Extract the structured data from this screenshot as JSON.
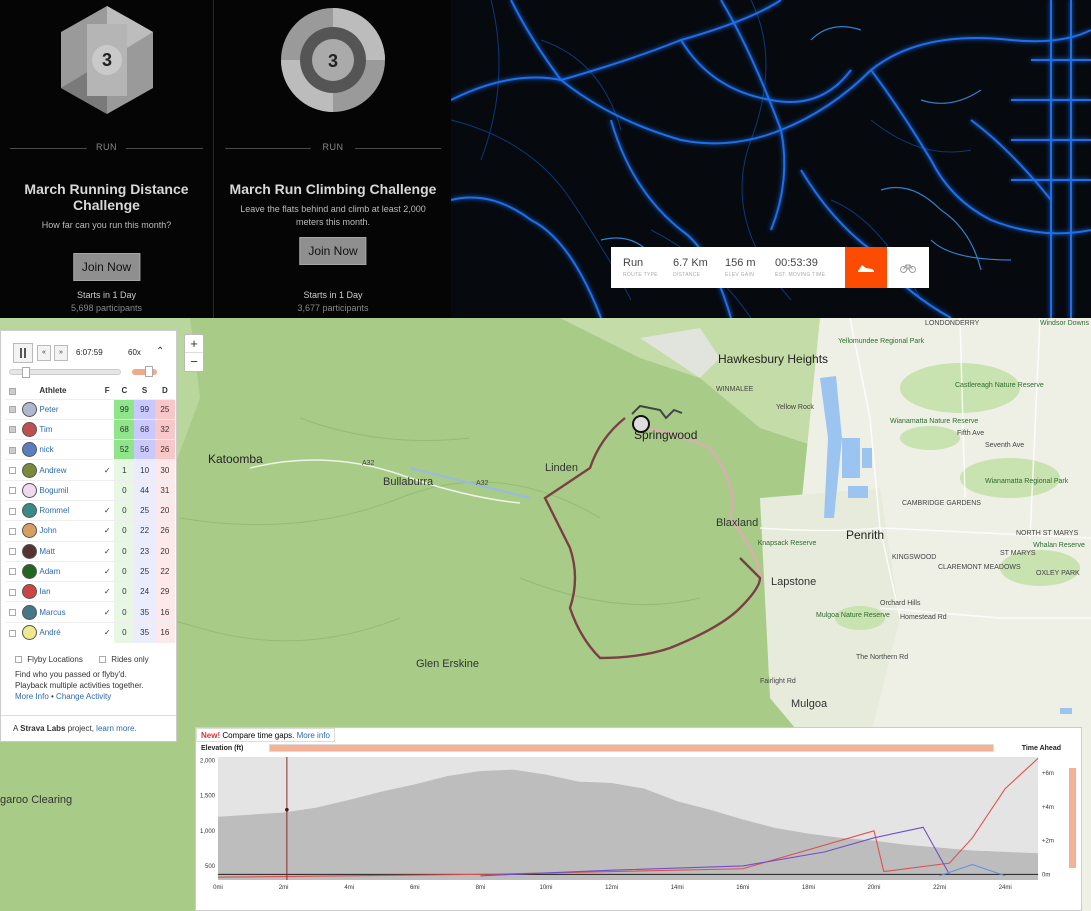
{
  "challenges": [
    {
      "badge_number": "3",
      "sport": "RUN",
      "title": "March Running Distance Challenge",
      "description": "How far can you run this month?",
      "button": "Join Now",
      "starts": "Starts in 1 Day",
      "participants": "5,698 participants"
    },
    {
      "badge_number": "3",
      "sport": "RUN",
      "title": "March Run Climbing Challenge",
      "description": "Leave the flats behind and climb at least 2,000 meters this month.",
      "button": "Join Now",
      "starts": "Starts in 1 Day",
      "participants": "3,677 participants"
    }
  ],
  "route_builder": {
    "type_value": "Run",
    "type_label": "ROUTE TYPE",
    "distance_value": "6.7 Km",
    "distance_label": "DISTANCE",
    "elev_value": "156 m",
    "elev_label": "ELEV GAIN",
    "time_value": "00:53:39",
    "time_label": "EST. MOVING TIME",
    "run_icon": "shoe-icon",
    "bike_icon": "bike-icon",
    "accent": "#fc4c02"
  },
  "playback": {
    "time": "6:07:59",
    "speed": "60x",
    "rewind": "«",
    "forward": "»"
  },
  "athlete_table": {
    "headers": {
      "athlete": "Athlete",
      "c": "C",
      "s": "S",
      "d": "D"
    },
    "rows": [
      {
        "name": "Peter",
        "checked": true,
        "flag": "",
        "c": "99",
        "s": "99",
        "d": "25",
        "color": "#b0b8d0"
      },
      {
        "name": "Tim",
        "checked": true,
        "flag": "",
        "c": "68",
        "s": "68",
        "d": "32",
        "color": "#c05050"
      },
      {
        "name": "nick",
        "checked": true,
        "flag": "",
        "c": "52",
        "s": "56",
        "d": "26",
        "color": "#5a7fc0"
      },
      {
        "name": "Andrew",
        "checked": false,
        "flag": "✓",
        "c": "1",
        "s": "10",
        "d": "30",
        "color": "#7a8a3a"
      },
      {
        "name": "Bogumil",
        "checked": false,
        "flag": "",
        "c": "0",
        "s": "44",
        "d": "31",
        "color": "#f0d8f0"
      },
      {
        "name": "Rommel",
        "checked": false,
        "flag": "✓",
        "c": "0",
        "s": "25",
        "d": "20",
        "color": "#3a8a8a"
      },
      {
        "name": "John",
        "checked": false,
        "flag": "✓",
        "c": "0",
        "s": "22",
        "d": "26",
        "color": "#d8a060"
      },
      {
        "name": "Matt",
        "checked": false,
        "flag": "✓",
        "c": "0",
        "s": "23",
        "d": "20",
        "color": "#553333"
      },
      {
        "name": "Adam",
        "checked": false,
        "flag": "✓",
        "c": "0",
        "s": "25",
        "d": "22",
        "color": "#226622"
      },
      {
        "name": "Ian",
        "checked": false,
        "flag": "✓",
        "c": "0",
        "s": "24",
        "d": "29",
        "color": "#cc4444"
      },
      {
        "name": "Marcus",
        "checked": false,
        "flag": "✓",
        "c": "0",
        "s": "35",
        "d": "16",
        "color": "#447788"
      },
      {
        "name": "André",
        "checked": false,
        "flag": "✓",
        "c": "0",
        "s": "35",
        "d": "16",
        "color": "#f0e890"
      }
    ]
  },
  "options": {
    "flyby_locations": "Flyby Locations",
    "rides_only": "Rides only"
  },
  "info": {
    "line1": "Find who you passed or flyby'd.",
    "line2": "Playback multiple activities together.",
    "more_info": "More Info",
    "separator": " • ",
    "change_activity": "Change Activity"
  },
  "footer": {
    "prefix": "A ",
    "brand": "Strava Labs",
    "middle": " project, ",
    "learn_more": "learn more."
  },
  "map_labels": {
    "katoomba": "Katoomba",
    "bullaburra": "Bullaburra",
    "linden": "Linden",
    "springwood": "Springwood",
    "hawkesbury": "Hawkesbury Heights",
    "blaxland": "Blaxland",
    "lapstone": "Lapstone",
    "penrith": "Penrith",
    "glen_erskine": "Glen Erskine",
    "mulgoa": "Mulgoa",
    "kangaroo": "garoo Clearing",
    "yellow_rock": "Yellow Rock",
    "winmalee": "WINMALEE",
    "kingswood": "KINGSWOOD",
    "cambridge": "CAMBRIDGE GARDENS",
    "claremont": "CLAREMONT MEADOWS",
    "north_st_marys": "NORTH ST MARYS",
    "st_marys": "ST MARYS",
    "londonderry": "LONDONDERRY",
    "yellomundee": "Yellomundee Regional Park",
    "castlereagh": "Castlereagh Nature Reserve",
    "wianamatta1": "Wianamatta Nature Reserve",
    "wianamatta2": "Wianamatta Regional Park",
    "knapsack": "Knapsack Reserve",
    "mulgoa_nr": "Mulgoa Nature Reserve",
    "whalan": "Whalan Reserve",
    "windsor_downs": "Windsor Downs Nature Reserve",
    "fifth_ave": "Fifth Ave",
    "seventh_ave": "Seventh Ave",
    "homestead": "Homestead Rd",
    "a32": "A32",
    "a32b": "A32",
    "orchard": "Orchard Hills",
    "northern": "The Northern Rd",
    "fairlight": "Fairlight Rd",
    "oxley": "OXLEY PARK"
  },
  "elevation": {
    "notice_new": "New!",
    "notice_text": " Compare time gaps. ",
    "notice_link": "More info",
    "title": "Elevation (ft)",
    "right_title": "Time Ahead"
  },
  "chart_data": {
    "type": "area",
    "xlabel": "",
    "ylabel": "Elevation (ft)",
    "x_ticks": [
      "0mi",
      "2mi",
      "4mi",
      "6mi",
      "8mi",
      "10mi",
      "12mi",
      "14mi",
      "16mi",
      "18mi",
      "20mi",
      "22mi",
      "24mi"
    ],
    "y_ticks": [
      "500",
      "1,000",
      "1,500",
      "2,000"
    ],
    "y2_ticks": [
      "0m",
      "+2m",
      "+4m",
      "+6m"
    ],
    "xlim": [
      0,
      25
    ],
    "ylim": [
      300,
      2050
    ],
    "cursor_x": 2.1,
    "elevation_profile": {
      "x": [
        0,
        1,
        2,
        3,
        4,
        5,
        6,
        7,
        8,
        9,
        10,
        11,
        12,
        13,
        14,
        15,
        16,
        17,
        18,
        19,
        20,
        21,
        22,
        23,
        24,
        25
      ],
      "y": [
        1200,
        1230,
        1260,
        1330,
        1440,
        1560,
        1660,
        1780,
        1850,
        1870,
        1800,
        1700,
        1680,
        1600,
        1420,
        1300,
        1160,
        1040,
        960,
        900,
        860,
        800,
        760,
        720,
        700,
        680
      ]
    },
    "series": [
      {
        "name": "",
        "color": "#e05050",
        "x": [
          0,
          4,
          8,
          12,
          16,
          20,
          20.3,
          22.3,
          23,
          24,
          25
        ],
        "y": [
          340,
          360,
          380,
          420,
          460,
          1000,
          420,
          540,
          900,
          1600,
          2030
        ]
      },
      {
        "name": "",
        "color": "#7050c8",
        "x": [
          8,
          12,
          16,
          18.5,
          20,
          21.5,
          22.3
        ],
        "y": [
          360,
          440,
          500,
          700,
          900,
          1050,
          380
        ]
      },
      {
        "name": "",
        "color": "#6090e0",
        "x": [
          22,
          23,
          24
        ],
        "y": [
          360,
          520,
          360
        ]
      }
    ]
  }
}
